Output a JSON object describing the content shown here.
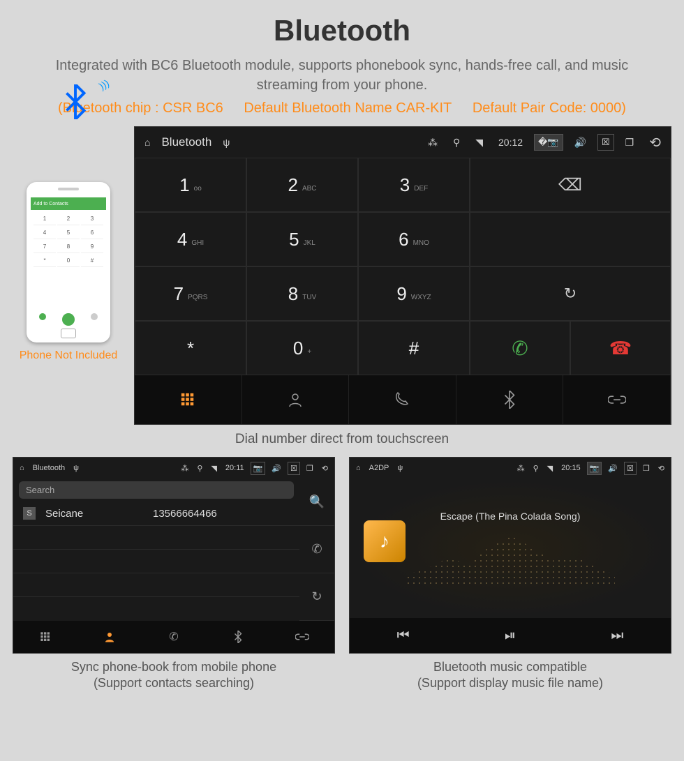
{
  "title": "Bluetooth",
  "description": "Integrated with BC6 Bluetooth module, supports phonebook sync, hands-free call, and music streaming from your phone.",
  "specs": {
    "chip": "(Bluetooth chip : CSR BC6",
    "name": "Default Bluetooth Name CAR-KIT",
    "pair": "Default Pair Code: 0000)"
  },
  "phone": {
    "caption": "Phone Not Included",
    "topbar": "Add to Contacts",
    "keys": [
      "1",
      "2",
      "3",
      "4",
      "5",
      "6",
      "7",
      "8",
      "9",
      "*",
      "0",
      "#"
    ]
  },
  "dialer": {
    "statusbar": {
      "title": "Bluetooth",
      "time": "20:12"
    },
    "keys": [
      {
        "num": "1",
        "sub": "oo"
      },
      {
        "num": "2",
        "sub": "ABC"
      },
      {
        "num": "3",
        "sub": "DEF"
      },
      {
        "num": "4",
        "sub": "GHI"
      },
      {
        "num": "5",
        "sub": "JKL"
      },
      {
        "num": "6",
        "sub": "MNO"
      },
      {
        "num": "7",
        "sub": "PQRS"
      },
      {
        "num": "8",
        "sub": "TUV"
      },
      {
        "num": "9",
        "sub": "WXYZ"
      },
      {
        "num": "*",
        "sub": ""
      },
      {
        "num": "0",
        "sub": "+"
      },
      {
        "num": "#",
        "sub": ""
      }
    ],
    "caption": "Dial number direct from touchscreen"
  },
  "phonebook": {
    "statusbar": {
      "title": "Bluetooth",
      "time": "20:11"
    },
    "search_placeholder": "Search",
    "contact": {
      "initial": "S",
      "name": "Seicane",
      "number": "13566664466"
    },
    "caption_line1": "Sync phone-book from mobile phone",
    "caption_line2": "(Support contacts searching)"
  },
  "music": {
    "statusbar": {
      "title": "A2DP",
      "time": "20:15"
    },
    "song": "Escape (The Pina Colada Song)",
    "caption_line1": "Bluetooth music compatible",
    "caption_line2": "(Support display music file name)"
  }
}
